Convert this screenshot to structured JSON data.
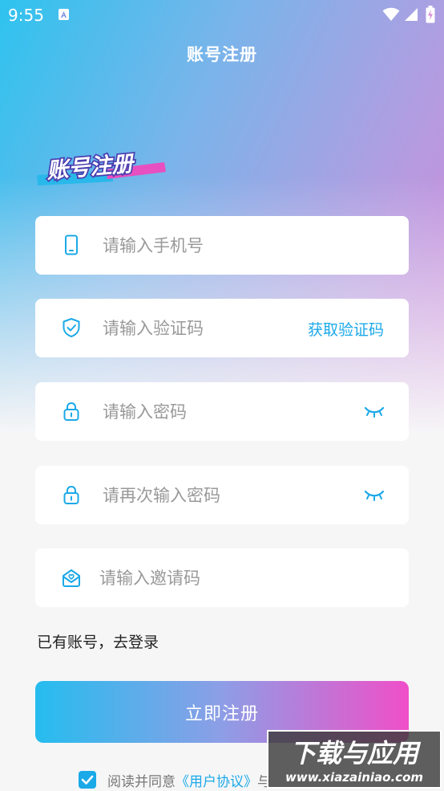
{
  "status_bar": {
    "time": "9:55",
    "icons": [
      "notification-a-icon",
      "wifi-icon",
      "signal-icon",
      "battery-charging-icon"
    ]
  },
  "header": {
    "title": "账号注册"
  },
  "logo": {
    "text": "账号注册",
    "colors": {
      "text": "#ffffff",
      "outline": "#4b3fb0",
      "stripe_left": "#29b8ea",
      "stripe_right": "#e84fc0"
    }
  },
  "form": {
    "phone": {
      "placeholder": "请输入手机号",
      "value": "",
      "icon": "phone-icon"
    },
    "code": {
      "placeholder": "请输入验证码",
      "value": "",
      "icon": "shield-check-icon",
      "get_code_label": "获取验证码"
    },
    "password": {
      "placeholder": "请输入密码",
      "value": "",
      "icon": "lock-icon",
      "toggle_icon": "eye-closed-icon"
    },
    "password_confirm": {
      "placeholder": "请再次输入密码",
      "value": "",
      "icon": "lock-icon",
      "toggle_icon": "eye-closed-icon"
    },
    "invite": {
      "placeholder": "请输入邀请码",
      "value": "",
      "icon": "envelope-heart-icon"
    }
  },
  "login_link": "已有账号，去登录",
  "register_button": "立即注册",
  "agreement": {
    "checked": true,
    "prefix": "阅读并同意",
    "link": "《用户协议》",
    "suffix": "与"
  },
  "watermark": {
    "text": "下载与应用",
    "url": "www.xiazainiao.com"
  },
  "colors": {
    "accent": "#1ba9e8",
    "gradient_start": "#25bdee",
    "gradient_end": "#f04fc8",
    "background": "#f6f6f7"
  }
}
